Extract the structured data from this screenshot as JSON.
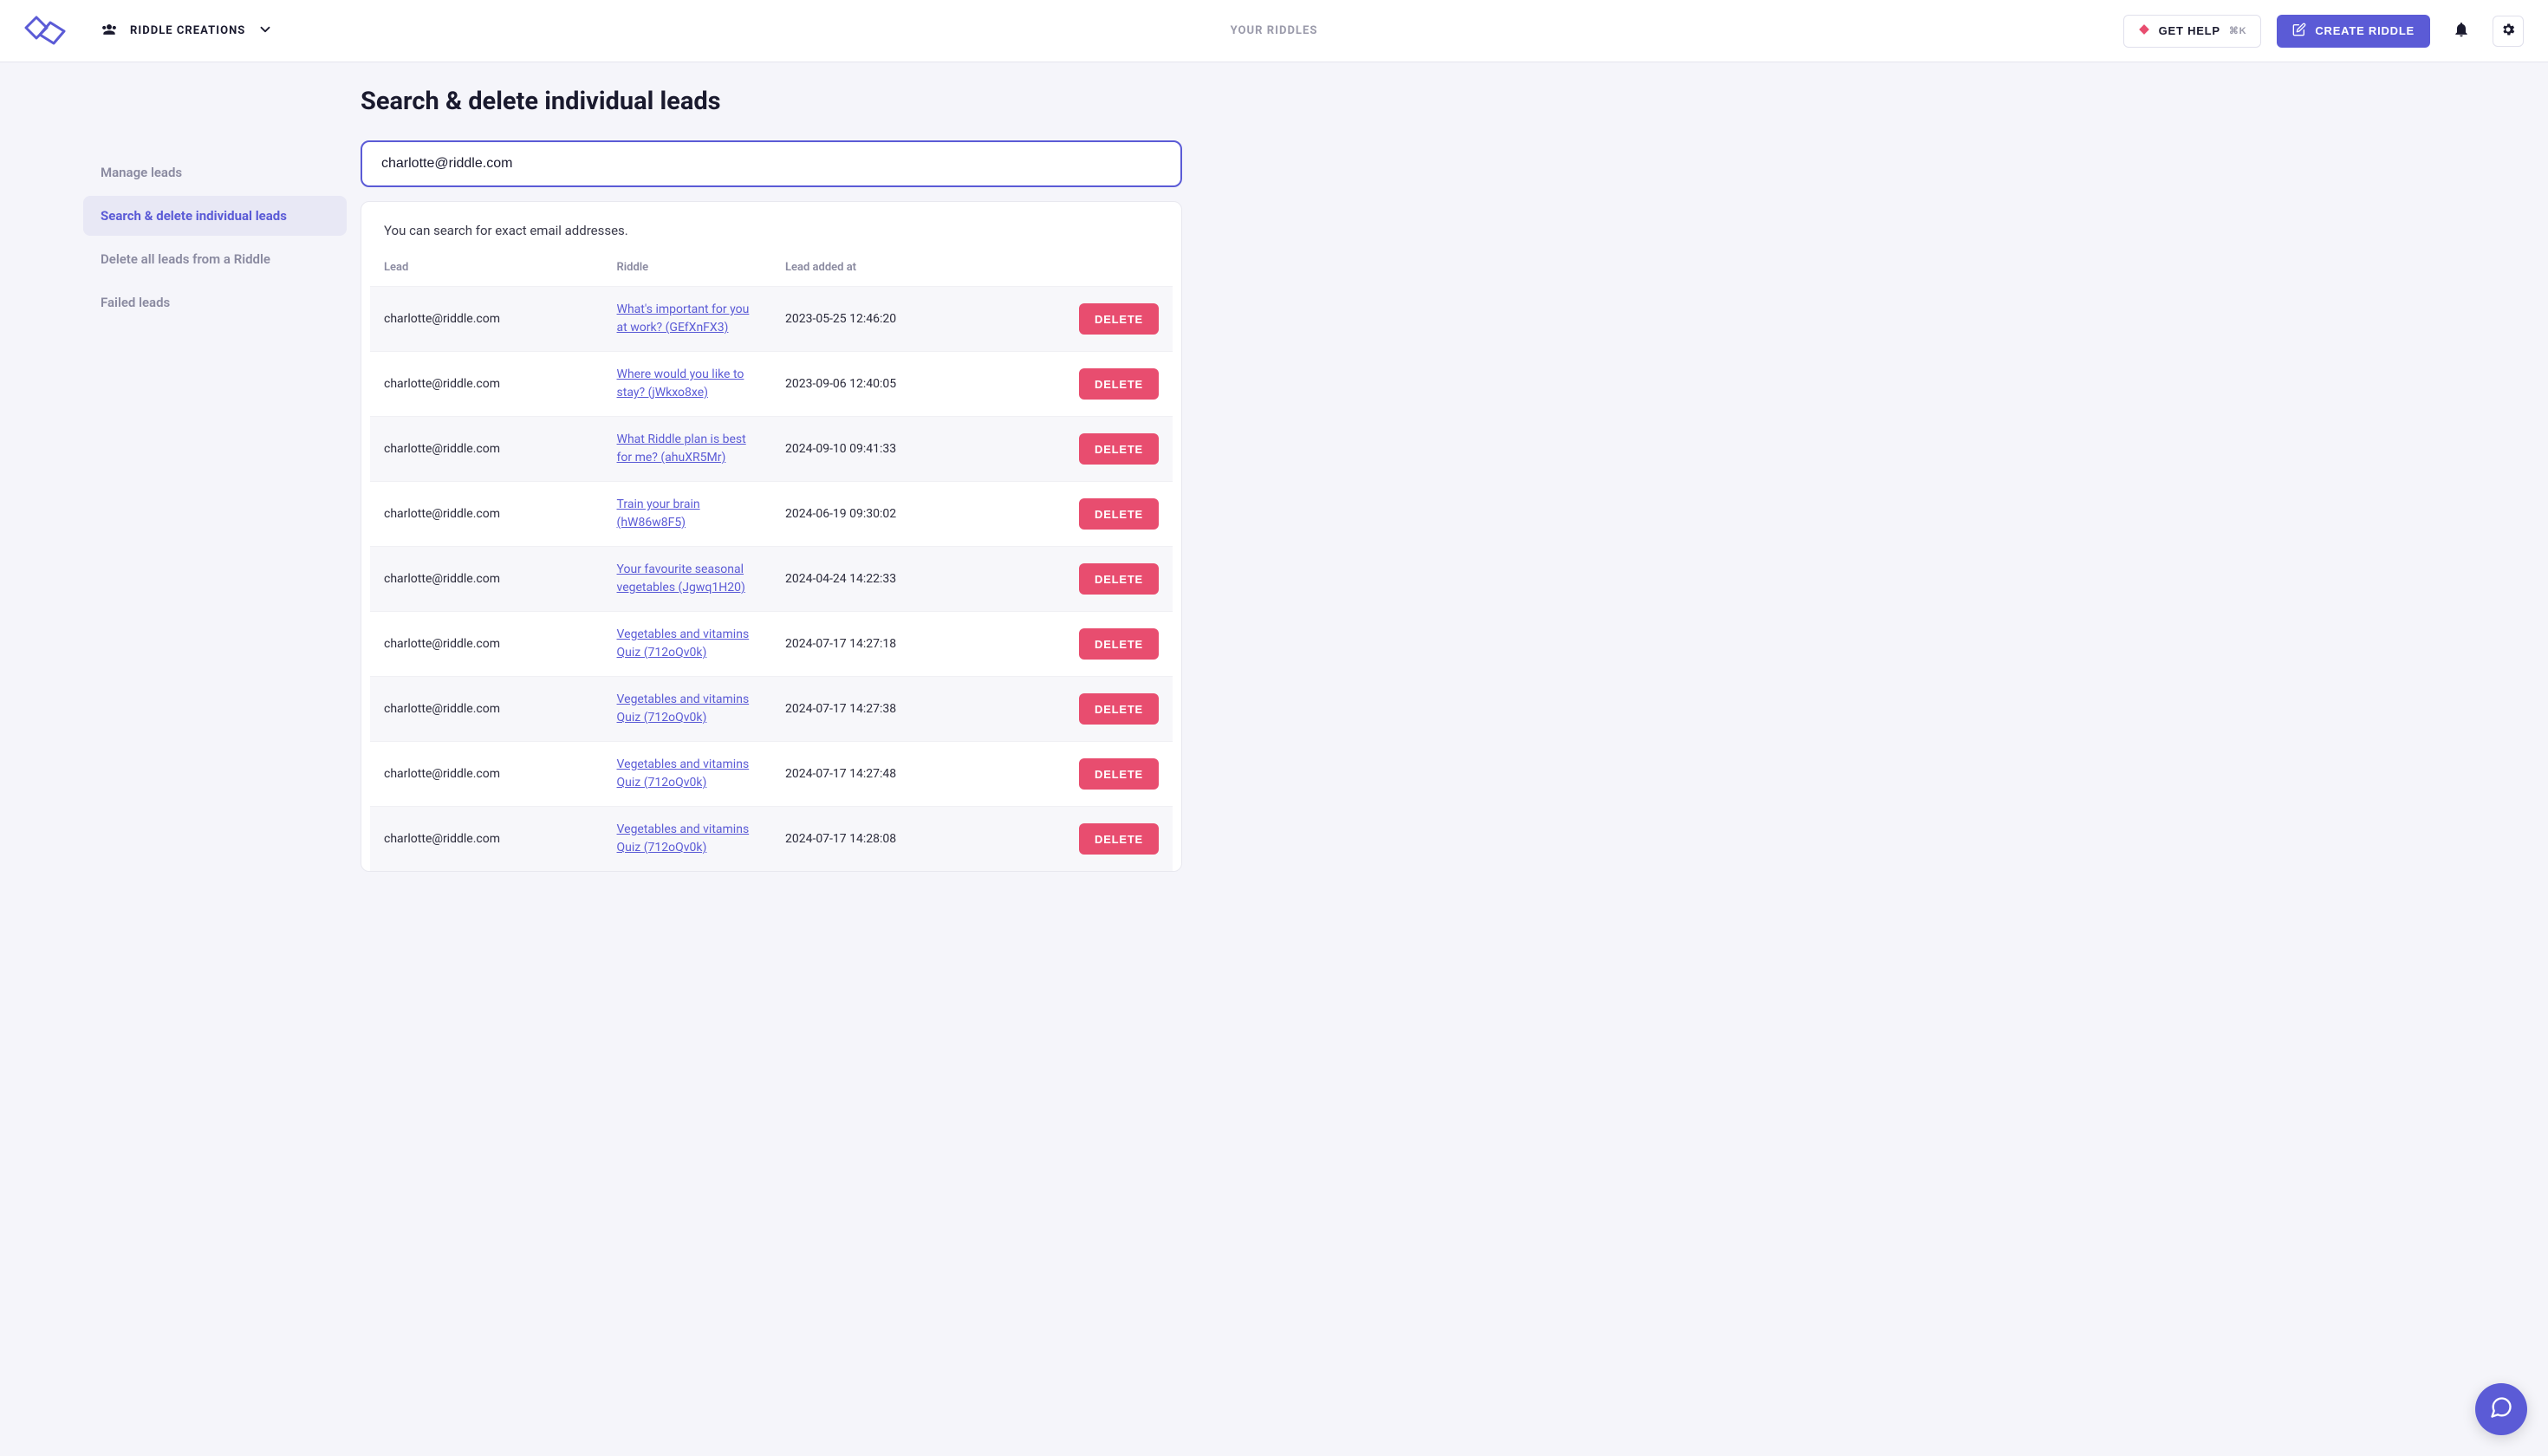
{
  "header": {
    "workspace_name": "RIDDLE CREATIONS",
    "center_nav": "YOUR RIDDLES",
    "help_label": "GET HELP",
    "help_shortcut": "⌘K",
    "create_label": "CREATE RIDDLE"
  },
  "sidebar": {
    "items": [
      {
        "label": "Manage leads",
        "active": false
      },
      {
        "label": "Search & delete individual leads",
        "active": true
      },
      {
        "label": "Delete all leads from a Riddle",
        "active": false
      },
      {
        "label": "Failed leads",
        "active": false
      }
    ]
  },
  "page": {
    "title": "Search & delete individual leads",
    "search_value": "charlotte@riddle.com",
    "search_hint": "You can search for exact email addresses."
  },
  "table": {
    "columns": {
      "lead": "Lead",
      "riddle": "Riddle",
      "added": "Lead added at"
    },
    "delete_label": "DELETE",
    "rows": [
      {
        "email": "charlotte@riddle.com",
        "riddle": "What's important for you at work? (GEfXnFX3)",
        "date": "2023-05-25 12:46:20"
      },
      {
        "email": "charlotte@riddle.com",
        "riddle": "Where would you like to stay? (jWkxo8xe)",
        "date": "2023-09-06 12:40:05"
      },
      {
        "email": "charlotte@riddle.com",
        "riddle": "What Riddle plan is best for me? (ahuXR5Mr)",
        "date": "2024-09-10 09:41:33"
      },
      {
        "email": "charlotte@riddle.com",
        "riddle": "Train your brain (hW86w8F5)",
        "date": "2024-06-19 09:30:02"
      },
      {
        "email": "charlotte@riddle.com",
        "riddle": "Your favourite seasonal vegetables (Jgwq1H20)",
        "date": "2024-04-24 14:22:33"
      },
      {
        "email": "charlotte@riddle.com",
        "riddle": "Vegetables and vitamins Quiz (712oQv0k)",
        "date": "2024-07-17 14:27:18"
      },
      {
        "email": "charlotte@riddle.com",
        "riddle": "Vegetables and vitamins Quiz (712oQv0k)",
        "date": "2024-07-17 14:27:38"
      },
      {
        "email": "charlotte@riddle.com",
        "riddle": "Vegetables and vitamins Quiz (712oQv0k)",
        "date": "2024-07-17 14:27:48"
      },
      {
        "email": "charlotte@riddle.com",
        "riddle": "Vegetables and vitamins Quiz (712oQv0k)",
        "date": "2024-07-17 14:28:08"
      }
    ]
  }
}
